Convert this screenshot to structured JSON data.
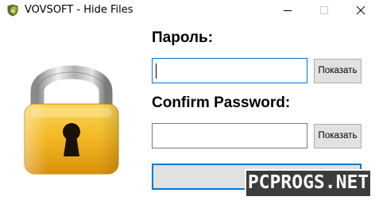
{
  "window": {
    "title": "VOVSOFT - Hide Files"
  },
  "icons": {
    "app": "shield-icon",
    "minimize": "minimize-icon",
    "maximize": "maximize-icon",
    "close": "close-icon",
    "lock": "padlock-icon"
  },
  "form": {
    "password_label": "Пароль:",
    "password_value": "",
    "show_password_label": "Показать",
    "confirm_label": "Confirm Password:",
    "confirm_value": "",
    "show_confirm_label": "Показать",
    "ok_label": "OK"
  },
  "watermark": {
    "text": "PCPROGS.NET"
  },
  "colors": {
    "focus_border": "#0078d7",
    "button_bg": "#e1e1e1",
    "lock_body": "#f2b822",
    "lock_shackle": "#b8b8b8"
  }
}
